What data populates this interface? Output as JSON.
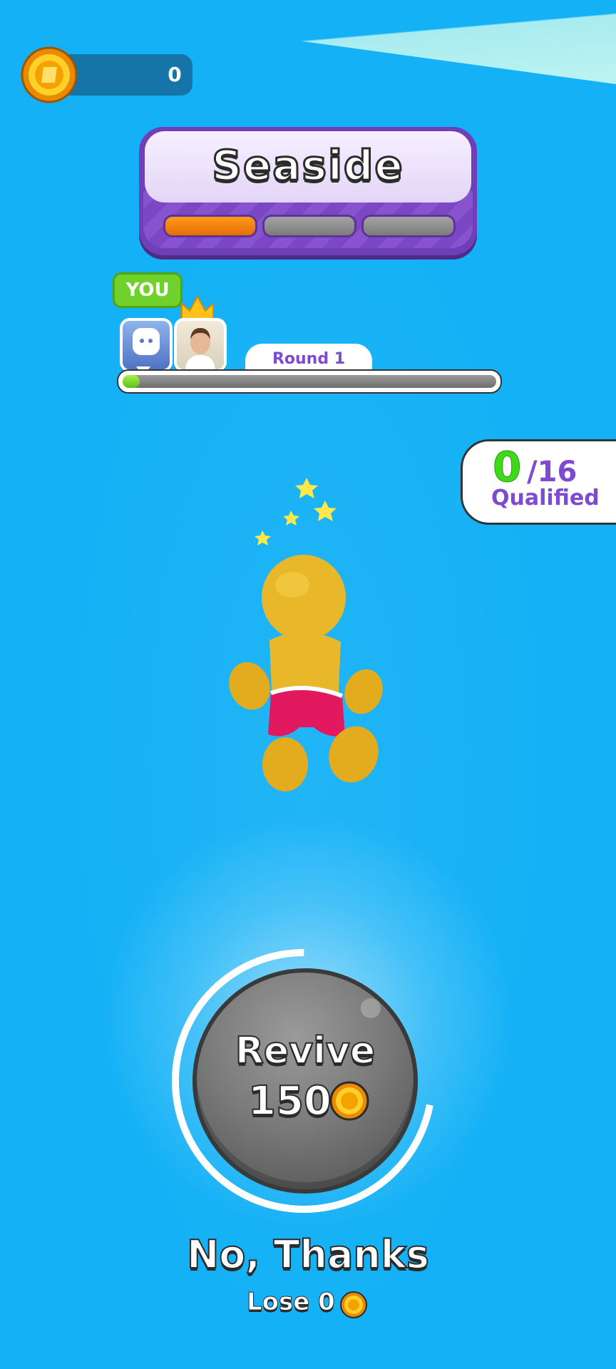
{
  "hud": {
    "coins": "0"
  },
  "level": {
    "name": "Seaside",
    "stages_completed": 1,
    "stages_total": 3
  },
  "players": {
    "you_tag": "YOU",
    "round_label": "Round 1",
    "round_progress": 0.04
  },
  "qualified": {
    "count": "0",
    "total": "/16",
    "label": "Qualified"
  },
  "revive": {
    "label": "Revive",
    "cost": "150",
    "timer_remaining": 0.72
  },
  "decline": {
    "label": "No, Thanks",
    "lose_text": "Lose 0"
  },
  "colors": {
    "background": "#14b1f6",
    "banner": "#6e3fb6",
    "stage_active": "#ff9a1a",
    "qualified_green": "#3fd91c",
    "accent_purple": "#7d4ad1"
  }
}
